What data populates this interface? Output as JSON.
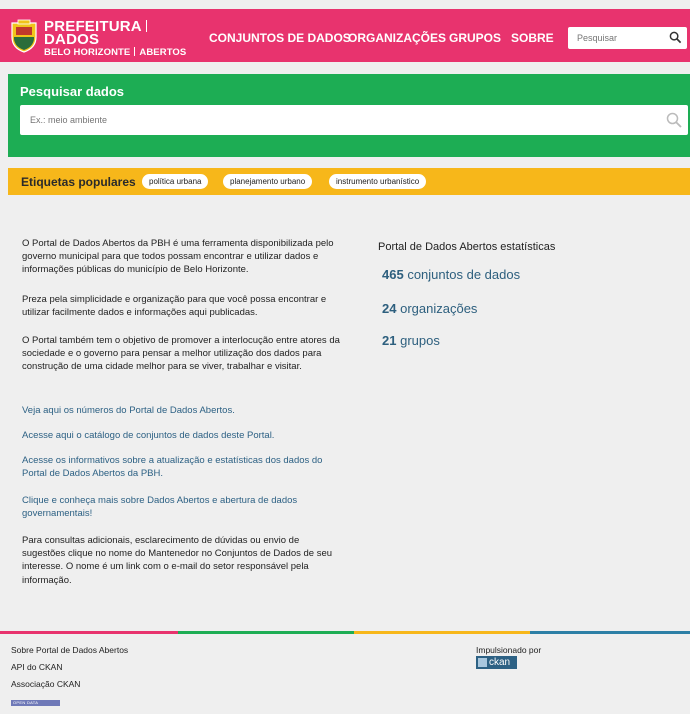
{
  "header": {
    "logo_line1a": "PREFEITURA",
    "logo_line1b": "DADOS",
    "logo_line2a": "BELO HORIZONTE",
    "logo_line2b": "ABERTOS",
    "nav": [
      "CONJUNTOS DE DADOS",
      "ORGANIZAÇÕES",
      "GRUPOS",
      "SOBRE"
    ],
    "search_placeholder": "Pesquisar",
    "color": "#e8336e"
  },
  "search": {
    "title": "Pesquisar dados",
    "placeholder": "Ex.: meio ambiente",
    "color": "#1dad54"
  },
  "tags": {
    "title": "Etiquetas populares",
    "items": [
      "política urbana",
      "planejamento urbano",
      "instrumento urbanístico"
    ],
    "color": "#f7b71a"
  },
  "content": {
    "p1": "O Portal de Dados Abertos da PBH é uma ferramenta disponibilizada pelo governo municipal para que todos possam encontrar e utilizar dados e informações públicas do município de Belo Horizonte.",
    "p2": "Preza pela simplicidade e organização para que você possa encontrar e utilizar facilmente dados e informações aqui publicadas.",
    "p3": "O Portal também tem o objetivo de promover a interlocução entre atores da sociedade e o governo para pensar a melhor utilização dos dados para construção de uma cidade melhor para se viver, trabalhar e visitar.",
    "link1": "Veja aqui os números do Portal de Dados Abertos.",
    "link2": "Acesse aqui o catálogo de conjuntos de dados deste Portal.",
    "link3": "Acesse os informativos sobre a atualização e estatísticas dos dados do Portal de Dados Abertos da PBH.",
    "link4": "Clique e conheça mais sobre Dados Abertos e abertura de dados governamentais!",
    "p4": "Para consultas adicionais, esclarecimento de dúvidas ou envio de sugestões clique no nome do Mantenedor no Conjuntos de Dados de seu interesse. O nome é um link com o e-mail do setor responsável pela informação."
  },
  "stats": {
    "title": "Portal de Dados Abertos estatísticas",
    "datasets_count": "465",
    "datasets_label": "conjuntos de dados",
    "orgs_count": "24",
    "orgs_label": "organizações",
    "groups_count": "21",
    "groups_label": "grupos"
  },
  "footer": {
    "links": [
      "Sobre Portal de Dados Abertos",
      "API do CKAN",
      "Associação CKAN"
    ],
    "powered_by": "Impulsionado por",
    "ckan": "ckan",
    "open_data_badge": "OPEN DATA",
    "stripe_colors": [
      "#e8336e",
      "#1dad54",
      "#f7b71a",
      "#2d7fa6"
    ]
  }
}
